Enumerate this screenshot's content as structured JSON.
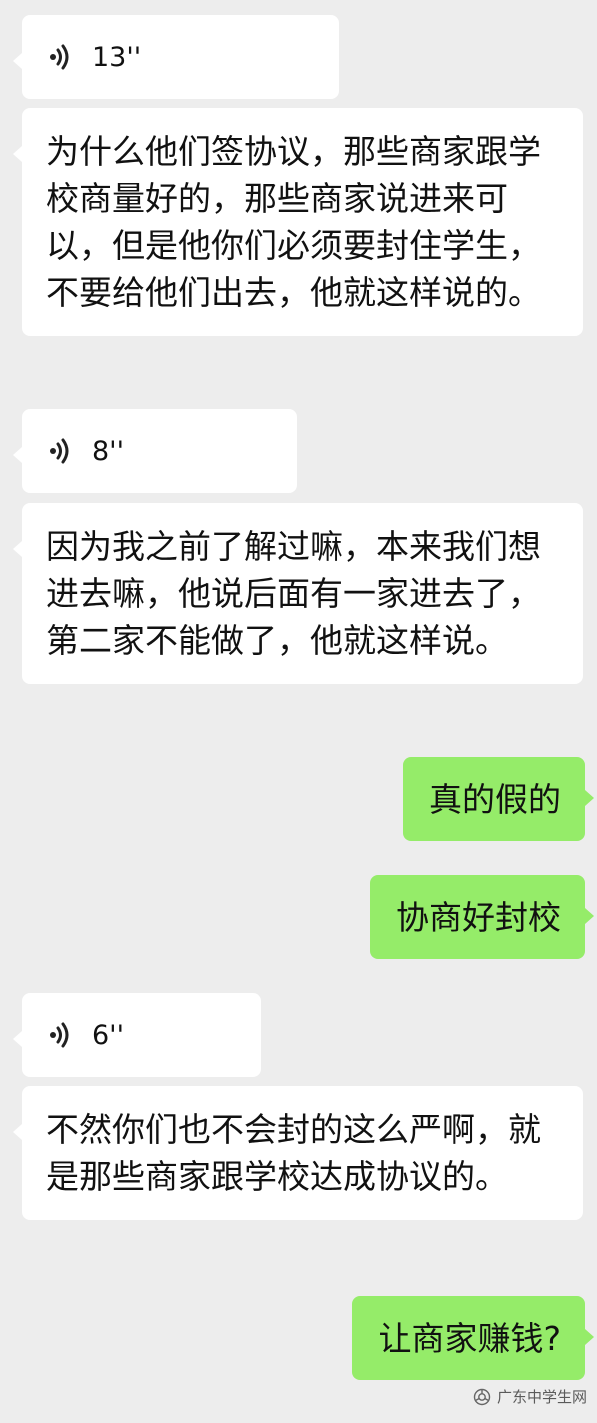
{
  "messages": [
    {
      "type": "voice",
      "duration": "13''"
    },
    {
      "type": "text",
      "text": "为什么他们签协议，那些商家跟学校商量好的，那些商家说进来可以，但是他你们必须要封住学生，不要给他们出去，他就这样说的。"
    },
    {
      "type": "voice",
      "duration": "8''"
    },
    {
      "type": "text",
      "text": "因为我之前了解过嘛，本来我们想进去嘛，他说后面有一家进去了，第二家不能做了，他就这样说。"
    },
    {
      "type": "sent",
      "text": "真的假的"
    },
    {
      "type": "sent",
      "text": "协商好封校"
    },
    {
      "type": "voice",
      "duration": "6''"
    },
    {
      "type": "text",
      "text": "不然你们也不会封的这么严啊，就是那些商家跟学校达成协议的。"
    },
    {
      "type": "sent",
      "text": "让商家赚钱?"
    }
  ],
  "watermark": {
    "text": "广东中学生网",
    "icon": "wechat-official-account-icon"
  },
  "colors": {
    "background": "#ededed",
    "received_bubble": "#ffffff",
    "sent_bubble": "#95ec69"
  }
}
